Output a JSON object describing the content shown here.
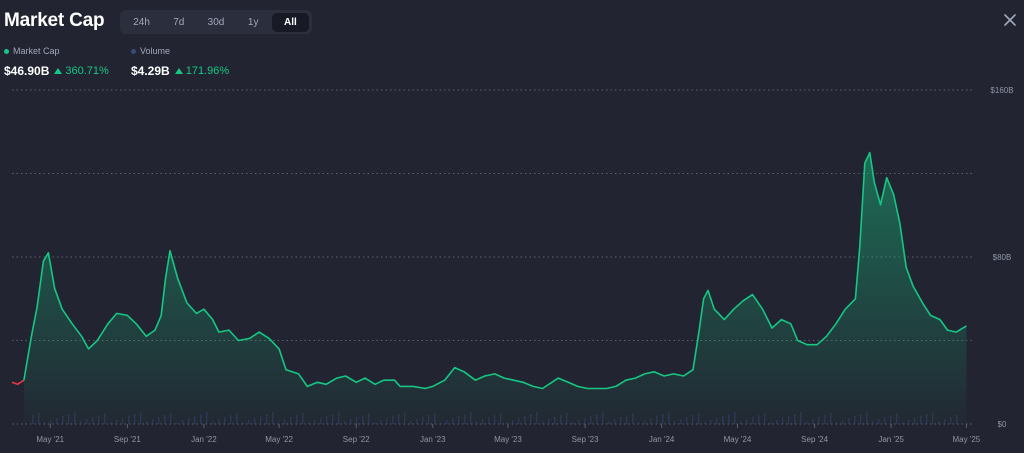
{
  "header": {
    "title": "Market Cap",
    "tabs": [
      {
        "label": "24h",
        "active": false
      },
      {
        "label": "7d",
        "active": false
      },
      {
        "label": "30d",
        "active": false
      },
      {
        "label": "1y",
        "active": false
      },
      {
        "label": "All",
        "active": true
      }
    ]
  },
  "legend": {
    "market_cap": {
      "label": "Market Cap",
      "value": "$46.90B",
      "change": "360.71%",
      "color": "#16c784"
    },
    "volume": {
      "label": "Volume",
      "value": "$4.29B",
      "change": "171.96%",
      "color": "#3a4a78"
    }
  },
  "chart_data": {
    "type": "area",
    "ylim": [
      0,
      160
    ],
    "y_ticks": [
      "$160B",
      "$80B",
      "$0"
    ],
    "y_tick_values": [
      160,
      80,
      0
    ],
    "x_ticks": [
      "May '21",
      "Sep '21",
      "Jan '22",
      "May '22",
      "Sep '22",
      "Jan '23",
      "May '23",
      "Sep '23",
      "Jan '24",
      "May '24",
      "Sep '24",
      "Jan '25",
      "May '25"
    ],
    "x_range": [
      "2021-03-01",
      "2025-05-10"
    ],
    "grid": true,
    "series": [
      {
        "name": "Market Cap",
        "color": "#16c784",
        "points": [
          [
            "2021-03-01",
            20
          ],
          [
            "2021-03-10",
            19
          ],
          [
            "2021-03-20",
            21
          ],
          [
            "2021-04-01",
            42
          ],
          [
            "2021-04-10",
            56
          ],
          [
            "2021-04-20",
            78
          ],
          [
            "2021-04-28",
            82
          ],
          [
            "2021-05-08",
            65
          ],
          [
            "2021-05-20",
            55
          ],
          [
            "2021-06-05",
            48
          ],
          [
            "2021-06-20",
            42
          ],
          [
            "2021-07-01",
            36
          ],
          [
            "2021-07-15",
            40
          ],
          [
            "2021-08-01",
            48
          ],
          [
            "2021-08-15",
            53
          ],
          [
            "2021-09-01",
            52
          ],
          [
            "2021-09-15",
            48
          ],
          [
            "2021-10-01",
            42
          ],
          [
            "2021-10-15",
            45
          ],
          [
            "2021-10-25",
            52
          ],
          [
            "2021-11-01",
            70
          ],
          [
            "2021-11-08",
            83
          ],
          [
            "2021-11-20",
            70
          ],
          [
            "2021-12-05",
            58
          ],
          [
            "2021-12-20",
            53
          ],
          [
            "2022-01-01",
            55
          ],
          [
            "2022-01-15",
            50
          ],
          [
            "2022-01-25",
            44
          ],
          [
            "2022-02-10",
            45
          ],
          [
            "2022-02-25",
            40
          ],
          [
            "2022-03-15",
            41
          ],
          [
            "2022-03-30",
            44
          ],
          [
            "2022-04-15",
            41
          ],
          [
            "2022-05-01",
            36
          ],
          [
            "2022-05-12",
            26
          ],
          [
            "2022-06-01",
            24
          ],
          [
            "2022-06-15",
            18
          ],
          [
            "2022-07-01",
            20
          ],
          [
            "2022-07-15",
            19
          ],
          [
            "2022-08-01",
            22
          ],
          [
            "2022-08-15",
            23
          ],
          [
            "2022-09-01",
            20
          ],
          [
            "2022-09-15",
            22
          ],
          [
            "2022-10-01",
            19
          ],
          [
            "2022-10-15",
            21
          ],
          [
            "2022-11-01",
            21
          ],
          [
            "2022-11-10",
            18
          ],
          [
            "2022-12-01",
            18
          ],
          [
            "2022-12-20",
            17
          ],
          [
            "2023-01-01",
            18
          ],
          [
            "2023-01-20",
            21
          ],
          [
            "2023-02-05",
            27
          ],
          [
            "2023-02-20",
            25
          ],
          [
            "2023-03-10",
            21
          ],
          [
            "2023-03-25",
            23
          ],
          [
            "2023-04-10",
            24
          ],
          [
            "2023-04-25",
            22
          ],
          [
            "2023-05-10",
            21
          ],
          [
            "2023-05-25",
            20
          ],
          [
            "2023-06-10",
            18
          ],
          [
            "2023-06-25",
            17
          ],
          [
            "2023-07-10",
            20
          ],
          [
            "2023-07-20",
            22
          ],
          [
            "2023-08-05",
            20
          ],
          [
            "2023-08-20",
            18
          ],
          [
            "2023-09-05",
            17
          ],
          [
            "2023-09-20",
            17
          ],
          [
            "2023-10-05",
            17
          ],
          [
            "2023-10-20",
            18
          ],
          [
            "2023-11-05",
            21
          ],
          [
            "2023-11-20",
            22
          ],
          [
            "2023-12-05",
            24
          ],
          [
            "2023-12-20",
            25
          ],
          [
            "2024-01-05",
            23
          ],
          [
            "2024-01-20",
            24
          ],
          [
            "2024-02-05",
            23
          ],
          [
            "2024-02-20",
            26
          ],
          [
            "2024-03-01",
            45
          ],
          [
            "2024-03-08",
            60
          ],
          [
            "2024-03-15",
            64
          ],
          [
            "2024-03-25",
            55
          ],
          [
            "2024-04-10",
            50
          ],
          [
            "2024-04-25",
            55
          ],
          [
            "2024-05-10",
            59
          ],
          [
            "2024-05-25",
            62
          ],
          [
            "2024-06-10",
            55
          ],
          [
            "2024-06-25",
            46
          ],
          [
            "2024-07-10",
            50
          ],
          [
            "2024-07-25",
            48
          ],
          [
            "2024-08-05",
            40
          ],
          [
            "2024-08-20",
            38
          ],
          [
            "2024-09-05",
            38
          ],
          [
            "2024-09-20",
            42
          ],
          [
            "2024-10-05",
            48
          ],
          [
            "2024-10-20",
            55
          ],
          [
            "2024-11-05",
            60
          ],
          [
            "2024-11-12",
            85
          ],
          [
            "2024-11-20",
            125
          ],
          [
            "2024-11-28",
            130
          ],
          [
            "2024-12-05",
            116
          ],
          [
            "2024-12-15",
            105
          ],
          [
            "2024-12-25",
            118
          ],
          [
            "2025-01-05",
            110
          ],
          [
            "2025-01-15",
            96
          ],
          [
            "2025-01-25",
            75
          ],
          [
            "2025-02-05",
            66
          ],
          [
            "2025-02-20",
            58
          ],
          [
            "2025-03-05",
            52
          ],
          [
            "2025-03-20",
            50
          ],
          [
            "2025-04-01",
            45
          ],
          [
            "2025-04-15",
            44
          ],
          [
            "2025-05-01",
            47
          ]
        ]
      }
    ],
    "recent_start": "2021-04-01",
    "early_color": "#ea3943"
  }
}
